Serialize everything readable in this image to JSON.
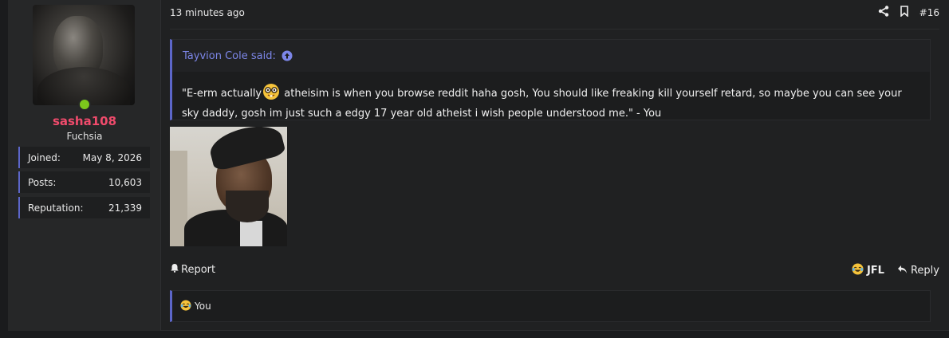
{
  "user": {
    "name": "sasha108",
    "title": "Fuchsia",
    "online": true,
    "stats": [
      {
        "label": "Joined:",
        "value": "May 8, 2026"
      },
      {
        "label": "Posts:",
        "value": "10,603"
      },
      {
        "label": "Reputation:",
        "value": "21,339"
      }
    ]
  },
  "post": {
    "time": "13 minutes ago",
    "number": "#16",
    "icons": [
      "share-icon",
      "bookmark-icon"
    ]
  },
  "quote": {
    "author": "Tayvion Cole said:",
    "text_before_emoji": "\"E-erm actually",
    "emoji": "nerd-face-icon",
    "text_after_emoji": " atheisim is when you browse reddit haha gosh, You should like freaking kill yourself retard, so maybe you can see your sky daddy, gosh im just such a edgy 17 year old atheist i wish people understood me.\" - You"
  },
  "footer": {
    "report_label": "Report",
    "react_label": "JFL",
    "reply_label": "Reply"
  },
  "reactions": {
    "text": "You"
  },
  "colors": {
    "accent": "#5c66c9",
    "username": "#f04b6c",
    "online": "#7cc81c",
    "quote_author": "#7c86e8"
  }
}
